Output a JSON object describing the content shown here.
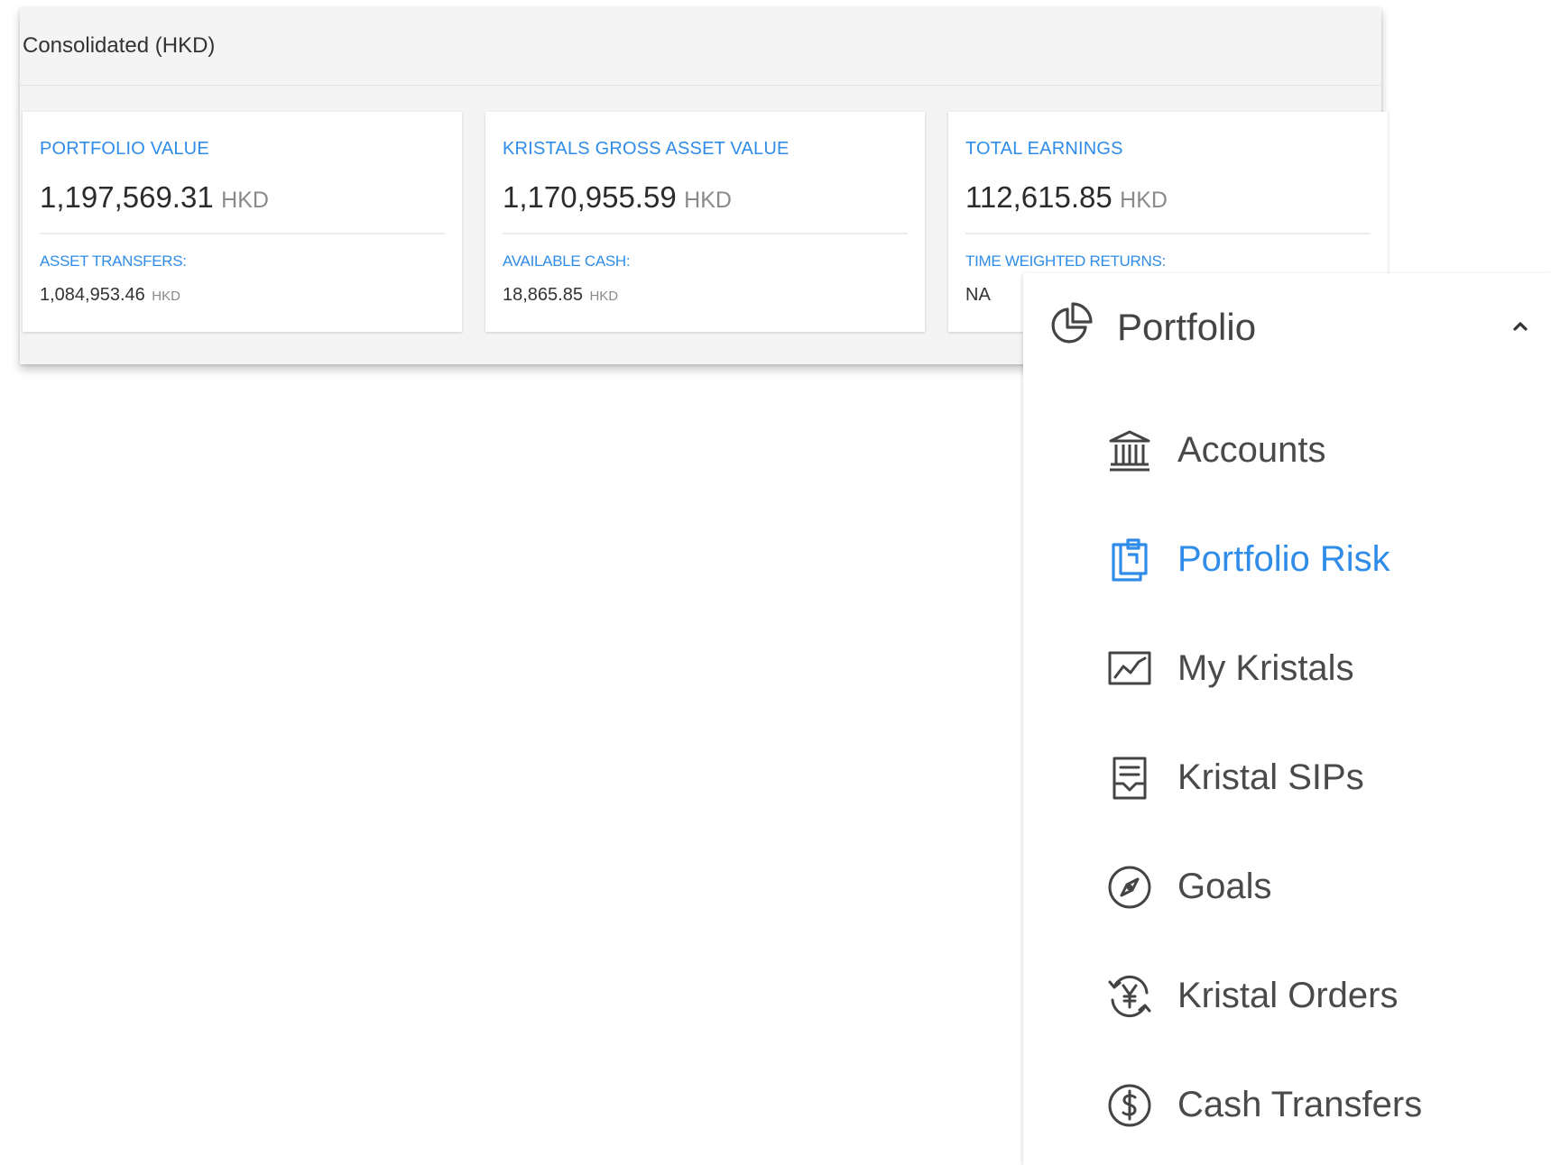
{
  "summary": {
    "title": "Consolidated (HKD)",
    "cards": [
      {
        "label": "PORTFOLIO VALUE",
        "value": "1,197,569.31",
        "currency": "HKD",
        "sublabel": "ASSET TRANSFERS:",
        "subvalue": "1,084,953.46",
        "subcurrency": "HKD"
      },
      {
        "label": "KRISTALS GROSS ASSET VALUE",
        "value": "1,170,955.59",
        "currency": "HKD",
        "sublabel": "AVAILABLE CASH:",
        "subvalue": "18,865.85",
        "subcurrency": "HKD"
      },
      {
        "label": "TOTAL EARNINGS",
        "value": "112,615.85",
        "currency": "HKD",
        "sublabel": "TIME WEIGHTED RETURNS:",
        "subvalue": "NA",
        "subcurrency": ""
      }
    ]
  },
  "menu": {
    "header": {
      "label": "Portfolio",
      "icon": "pie-chart-icon",
      "expanded": true
    },
    "accent_color": "#2f8ce8",
    "items": [
      {
        "label": "Accounts",
        "icon": "bank-icon",
        "active": false
      },
      {
        "label": "Portfolio Risk",
        "icon": "clipboard-icon",
        "active": true
      },
      {
        "label": "My Kristals",
        "icon": "line-chart-icon",
        "active": false
      },
      {
        "label": "Kristal SIPs",
        "icon": "receipt-icon",
        "active": false
      },
      {
        "label": "Goals",
        "icon": "compass-icon",
        "active": false
      },
      {
        "label": "Kristal Orders",
        "icon": "yen-exchange-icon",
        "active": false
      },
      {
        "label": "Cash Transfers",
        "icon": "dollar-circle-icon",
        "active": false
      }
    ]
  }
}
